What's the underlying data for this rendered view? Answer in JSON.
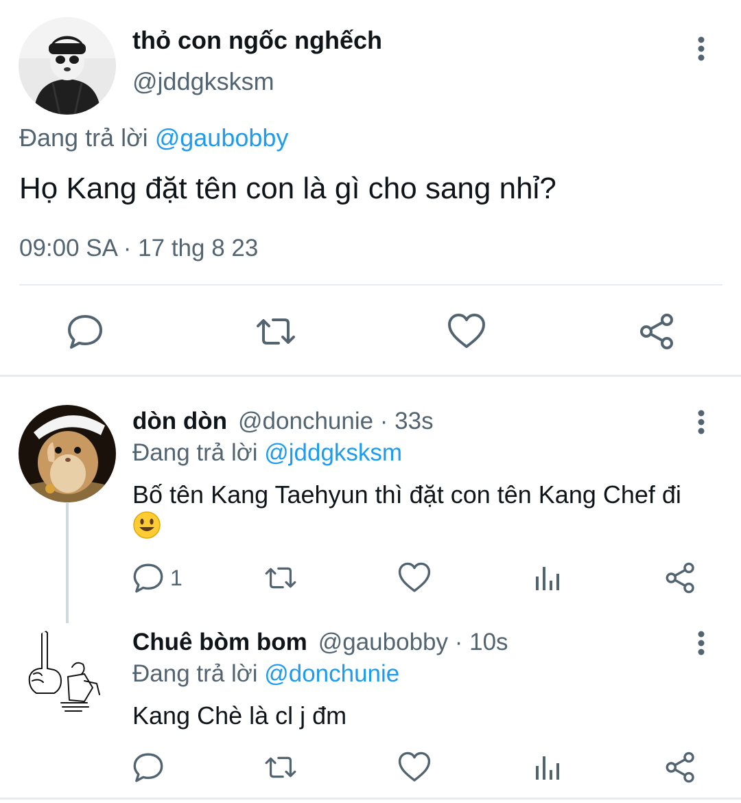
{
  "main_tweet": {
    "display_name": "thỏ con ngốc nghếch",
    "handle": "@jddgksksm",
    "replying_prefix": "Đang trả lời",
    "replying_to": "@gaubobby",
    "text": "Họ Kang đặt tên con là gì cho sang nhỉ?",
    "timestamp": "09:00 SA · 17 thg 8 23",
    "actions": [
      "reply-icon",
      "retweet-icon",
      "like-icon",
      "share-icon"
    ]
  },
  "replies": [
    {
      "display_name": "dòn dòn",
      "handle": "@donchunie · 33s",
      "replying_prefix": "Đang trả lời",
      "replying_to": "@jddgksksm",
      "text": "Bố tên Kang Taehyun thì đặt con tên Kang Chef đi",
      "emoji": "smiling-face-emoji",
      "reply_count": "1"
    },
    {
      "display_name": "Chuê bòm bom",
      "handle": "@gaubobby · 10s",
      "replying_prefix": "Đang trả lời",
      "replying_to": "@donchunie",
      "text": "Kang Chè là cl j đm"
    }
  ],
  "colors": {
    "text": "#0f1419",
    "secondary": "#536471",
    "link": "#1d9bf0",
    "divider": "#e6ecf0"
  }
}
